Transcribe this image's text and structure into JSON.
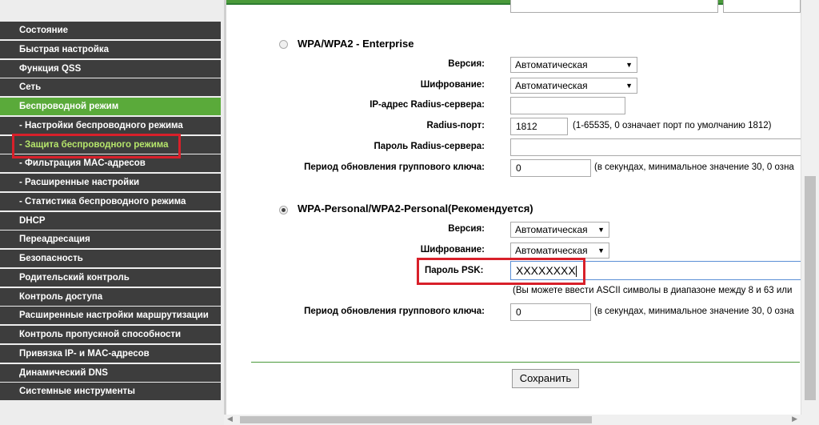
{
  "sidebar": {
    "items": [
      {
        "label": "Состояние"
      },
      {
        "label": "Быстрая настройка"
      },
      {
        "label": "Функция QSS"
      },
      {
        "label": "Сеть"
      },
      {
        "label": "Беспроводной режим"
      },
      {
        "label": "- Настройки беспроводного режима"
      },
      {
        "label": "- Защита беспроводного режима"
      },
      {
        "label": "- Фильтрация MAC-адресов"
      },
      {
        "label": "- Расширенные настройки"
      },
      {
        "label": "- Статистика беспроводного режима"
      },
      {
        "label": "DHCP"
      },
      {
        "label": "Переадресация"
      },
      {
        "label": "Безопасность"
      },
      {
        "label": "Родительский контроль"
      },
      {
        "label": "Контроль доступа"
      },
      {
        "label": "Расширенные настройки маршрутизации"
      },
      {
        "label": "Контроль пропускной способности"
      },
      {
        "label": "Привязка IP- и MAC-адресов"
      },
      {
        "label": "Динамический DNS"
      },
      {
        "label": "Системные инструменты"
      }
    ]
  },
  "enterprise": {
    "title": "WPA/WPA2 - Enterprise",
    "version_label": "Версия:",
    "version_value": "Автоматическая",
    "encryption_label": "Шифрование:",
    "encryption_value": "Автоматическая",
    "radius_ip_label": "IP-адрес Radius-сервера:",
    "radius_ip_value": "",
    "radius_port_label": "Radius-порт:",
    "radius_port_value": "1812",
    "radius_port_hint": "(1-65535, 0 означает порт по умолчанию 1812)",
    "radius_pwd_label": "Пароль Radius-сервера:",
    "radius_pwd_value": "",
    "group_key_label": "Период обновления группового ключа:",
    "group_key_value": "0",
    "group_key_hint": "(в секундах, минимальное значение 30, 0 озна"
  },
  "personal": {
    "title": "WPA-Personal/WPA2-Personal(Рекомендуется)",
    "version_label": "Версия:",
    "version_value": "Автоматическая",
    "encryption_label": "Шифрование:",
    "encryption_value": "Автоматическая",
    "psk_label": "Пароль PSK:",
    "psk_value": "XXXXXXXX",
    "psk_hint": "(Вы можете ввести ASCII символы в диапазоне между 8 и 63 или",
    "group_key_label": "Период обновления группового ключа:",
    "group_key_value": "0",
    "group_key_hint": "(в секундах, минимальное значение 30, 0 озна"
  },
  "save_label": "Сохранить",
  "icons": {
    "dropdown": "triangle-down-icon",
    "scroll_left": "triangle-left-icon",
    "scroll_right": "triangle-right-icon"
  },
  "colors": {
    "accent": "#5aaa3a",
    "highlight": "#d8202a",
    "menu_bg": "#3d3d3d"
  }
}
